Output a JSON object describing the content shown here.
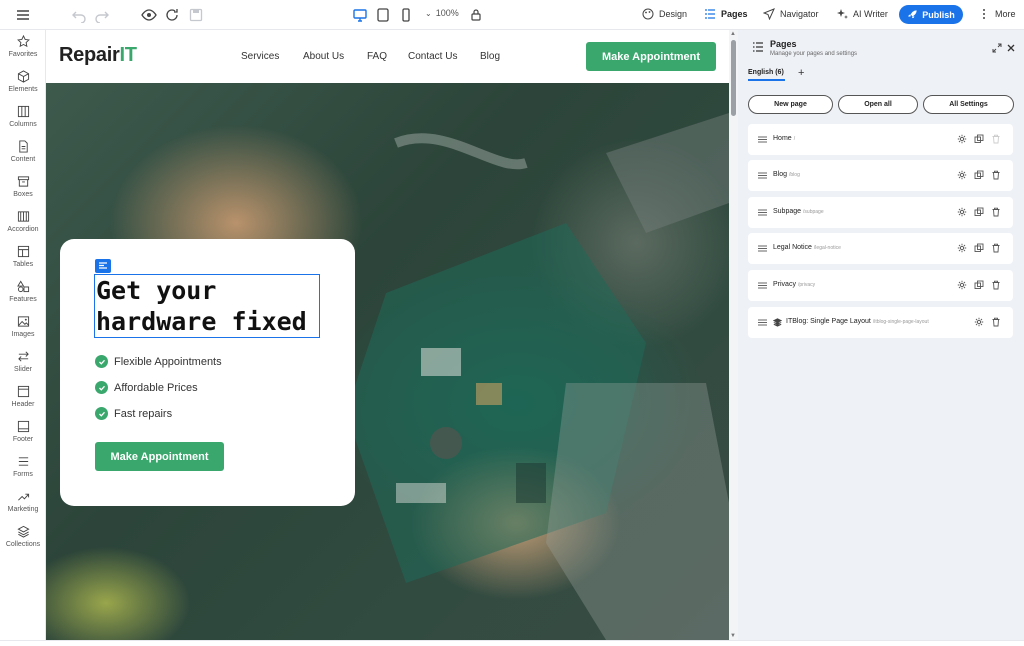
{
  "toolbar": {
    "zoom": "100%",
    "design_label": "Design",
    "pages_label": "Pages",
    "navigator_label": "Navigator",
    "ai_writer_label": "AI Writer",
    "publish_label": "Publish",
    "more_label": "More"
  },
  "sidebar": {
    "items": [
      {
        "label": "Favorites",
        "icon": "star-icon"
      },
      {
        "label": "Elements",
        "icon": "cube-icon"
      },
      {
        "label": "Columns",
        "icon": "columns-icon"
      },
      {
        "label": "Content",
        "icon": "document-icon"
      },
      {
        "label": "Boxes",
        "icon": "archive-icon"
      },
      {
        "label": "Accordion",
        "icon": "accordion-icon"
      },
      {
        "label": "Tables",
        "icon": "table-icon"
      },
      {
        "label": "Features",
        "icon": "shapes-icon"
      },
      {
        "label": "Images",
        "icon": "image-icon"
      },
      {
        "label": "Slider",
        "icon": "arrows-icon"
      },
      {
        "label": "Header",
        "icon": "header-icon"
      },
      {
        "label": "Footer",
        "icon": "footer-icon"
      },
      {
        "label": "Forms",
        "icon": "form-icon"
      },
      {
        "label": "Marketing",
        "icon": "trend-icon"
      },
      {
        "label": "Collections",
        "icon": "stack-icon"
      }
    ]
  },
  "site": {
    "logo_main": "Repair",
    "logo_accent": "IT",
    "nav": [
      "Services",
      "About Us",
      "FAQ",
      "Contact Us",
      "Blog"
    ],
    "header_button": "Make Appointment",
    "hero": {
      "headline_line1": "Get your",
      "headline_line2": "hardware fixed",
      "features": [
        "Flexible Appointments",
        "Affordable Prices",
        "Fast repairs"
      ],
      "button": "Make Appointment"
    }
  },
  "panel": {
    "title": "Pages",
    "subtitle": "Manage your pages and settings",
    "language_tab": "English (6)",
    "add_language": "+",
    "buttons": [
      "New page",
      "Open all",
      "All Settings"
    ],
    "pages": [
      {
        "name": "Home",
        "slug": "/"
      },
      {
        "name": "Blog",
        "slug": "/blog"
      },
      {
        "name": "Subpage",
        "slug": "/subpage"
      },
      {
        "name": "Legal Notice",
        "slug": "/legal-notice"
      },
      {
        "name": "Privacy",
        "slug": "/privacy"
      },
      {
        "name": "ITBlog: Single Page Layout",
        "slug": "/itblog-single-page-layout"
      }
    ]
  },
  "colors": {
    "accent_blue": "#1a73e8",
    "brand_green": "#3aa76d"
  }
}
